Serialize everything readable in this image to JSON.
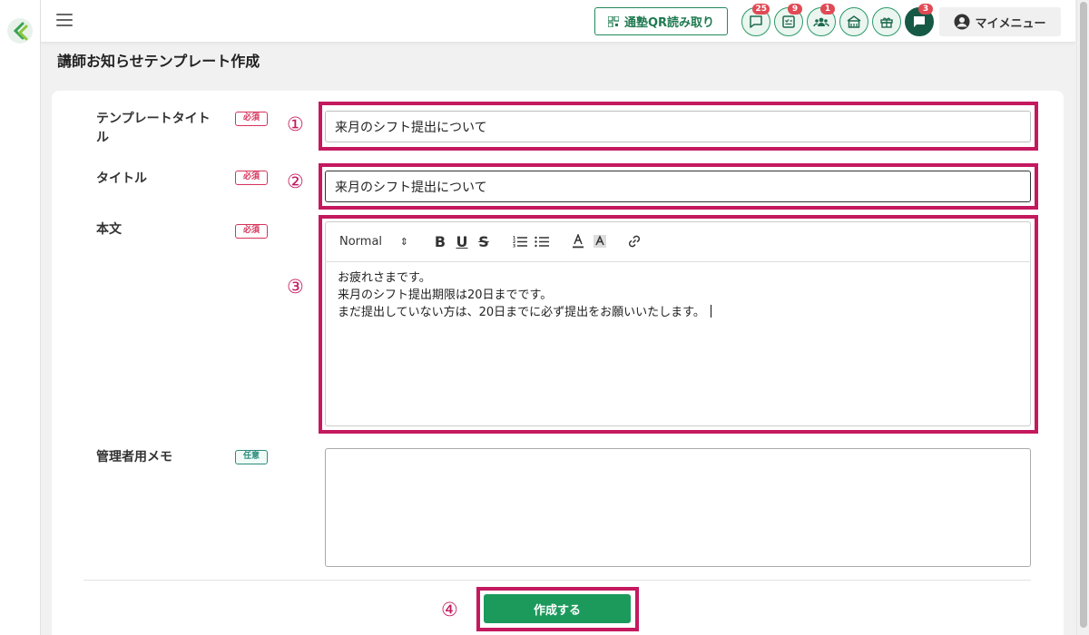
{
  "topbar": {
    "qr_button_label": "通塾QR読み取り",
    "badges": {
      "messages": "25",
      "tasks": "9",
      "users": "1",
      "chat": "3"
    },
    "my_menu_label": "マイメニュー"
  },
  "page": {
    "title": "講師お知らせテンプレート作成"
  },
  "form": {
    "template_title": {
      "label_line1": "テンプレートタイト",
      "label_line2": "ル",
      "tag": "必須",
      "value": "来月のシフト提出について",
      "marker": "①"
    },
    "title": {
      "label": "タイトル",
      "tag": "必須",
      "value": "来月のシフト提出について",
      "marker": "②"
    },
    "body": {
      "label": "本文",
      "tag": "必須",
      "marker": "③",
      "toolbar": {
        "format": "Normal",
        "format_arrow": "⇕"
      },
      "lines": [
        "お疲れさまです。",
        "来月のシフト提出期限は20日までです。",
        "まだ提出していない方は、20日までに必ず提出をお願いいたします。"
      ]
    },
    "memo": {
      "label": "管理者用メモ",
      "tag": "任意",
      "value": ""
    }
  },
  "submit": {
    "label": "作成する",
    "marker": "④"
  },
  "colors": {
    "accent_green": "#1c9a5c",
    "highlight": "#c4195f",
    "required_tag": "#d6335b",
    "optional_tag": "#2a8c7a"
  }
}
